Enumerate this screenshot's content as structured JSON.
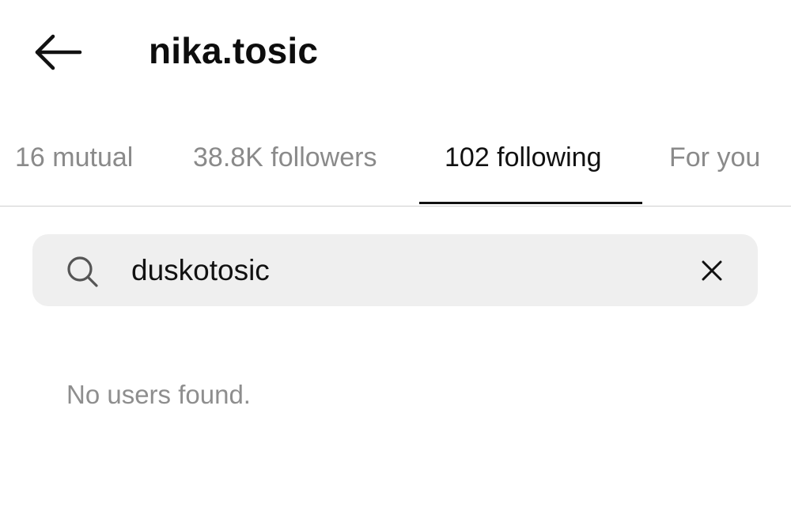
{
  "header": {
    "back_icon": "arrow-left-icon",
    "username": "nika.tosic"
  },
  "tabs": [
    {
      "label": "16 mutual",
      "active": false
    },
    {
      "label": "38.8K followers",
      "active": false
    },
    {
      "label": "102 following",
      "active": true
    },
    {
      "label": "For you",
      "active": false
    }
  ],
  "search": {
    "icon": "search-icon",
    "value": "duskotosic",
    "clear_icon": "close-icon"
  },
  "results": {
    "empty_message": "No users found."
  },
  "colors": {
    "text_primary": "#111111",
    "text_secondary": "#8a8a8a",
    "search_bg": "#efefef",
    "divider": "#cfcfcf"
  }
}
